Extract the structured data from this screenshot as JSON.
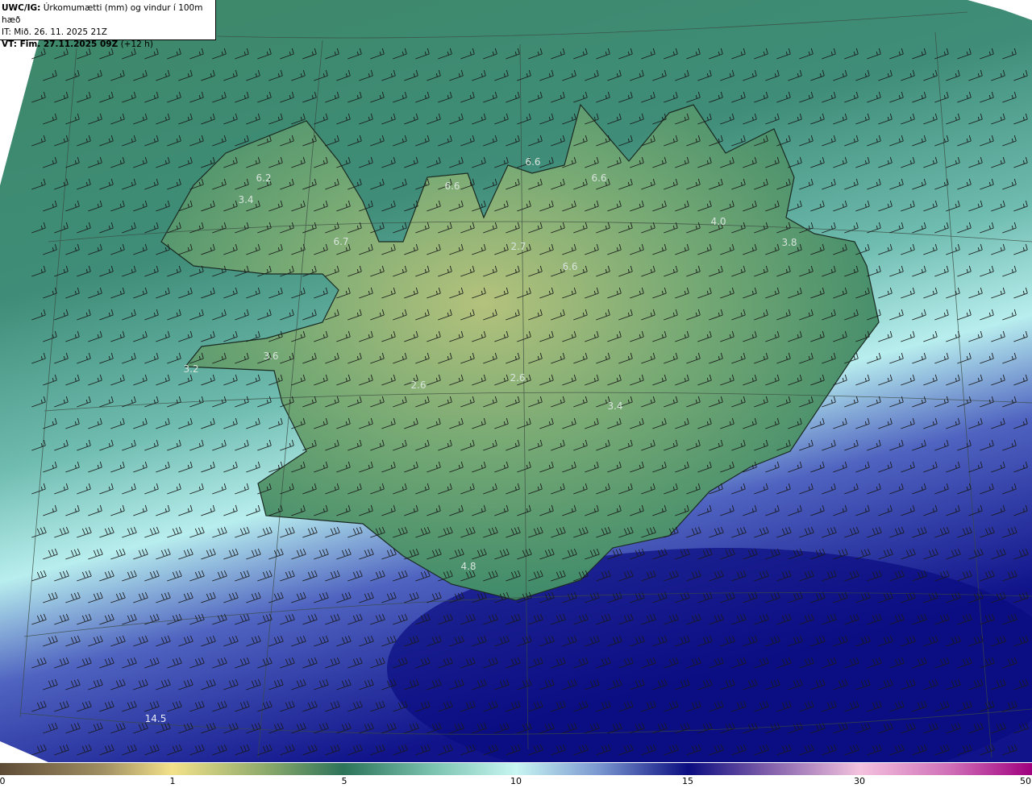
{
  "header": {
    "model": "UWC/IG:",
    "description": "Úrkomumætti (mm) og vindur í 100m hæð",
    "init_time": "IT: Mið. 26. 11. 2025 21Z",
    "valid_label": "VT: Fim. 27.11.2025 09Z",
    "valid_offset": "(+12 h)"
  },
  "map_values": [
    "6.2",
    "3.4",
    "6.7",
    "6.6",
    "6.6",
    "6.6",
    "4.0",
    "3.8",
    "2.7",
    "6.6",
    "3.6",
    "3.2",
    "2.6",
    "2.6",
    "3.4",
    "4.8",
    "14.5"
  ],
  "colorbar": {
    "ticks": [
      "0",
      "1",
      "5",
      "10",
      "15",
      "30",
      "50"
    ],
    "colors": [
      "#5e4b36",
      "#f3e28a",
      "#2c735a",
      "#c8f6f2",
      "#0a0c80",
      "#f4c2de",
      "#a0007e"
    ]
  }
}
